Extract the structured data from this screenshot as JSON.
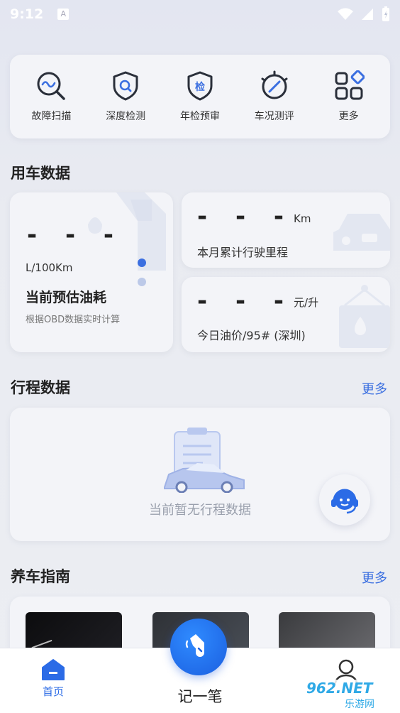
{
  "status_bar": {
    "time": "9:12",
    "notification_icon": "A"
  },
  "quick_actions": [
    {
      "label": "故障扫描",
      "icon": "scan-wave-icon"
    },
    {
      "label": "深度检测",
      "icon": "shield-search-icon"
    },
    {
      "label": "年检预审",
      "icon": "shield-inspection-icon",
      "icon_text": "检"
    },
    {
      "label": "车况测评",
      "icon": "gauge-icon"
    },
    {
      "label": "更多",
      "icon": "grid-more-icon"
    }
  ],
  "vehicle_data": {
    "title": "用车数据",
    "fuel": {
      "value": "- - -",
      "unit": "L/100Km",
      "label": "当前预估油耗",
      "desc": "根据OBD数据实时计算"
    },
    "mileage": {
      "value": "- - -",
      "unit": "Km",
      "label": "本月累计行驶里程"
    },
    "price": {
      "value": "- - -",
      "unit": "元/升",
      "label": "今日油价/95# (深圳)"
    }
  },
  "trip_data": {
    "title": "行程数据",
    "more": "更多",
    "empty": "当前暂无行程数据"
  },
  "care_guide": {
    "title": "养车指南",
    "more": "更多"
  },
  "bottom_nav": {
    "home": "首页",
    "record": "记一笔",
    "watermark": "962.NET",
    "watermark_sub": "乐游网"
  },
  "colors": {
    "accent": "#3b6fe0",
    "fab": "#1b5fe0"
  }
}
